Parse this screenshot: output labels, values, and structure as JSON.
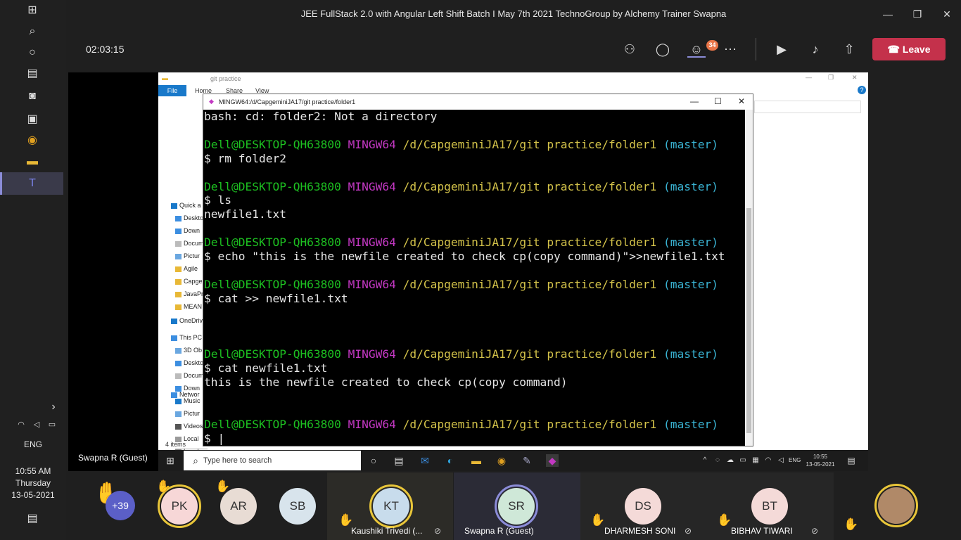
{
  "window": {
    "title": "JEE FullStack 2.0 with Angular Left Shift Batch I May 7th 2021 TechnoGroup by Alchemy Trainer Swapna"
  },
  "toolbar": {
    "timer": "02:03:15",
    "participants_badge": "34",
    "leave_label": "Leave",
    "icons": [
      "people-icon",
      "chat-icon",
      "reactions-icon",
      "more-icon",
      "camera-off-icon",
      "mic-off-icon",
      "share-icon"
    ]
  },
  "explorer": {
    "path": "git practice",
    "ribbon": [
      "File",
      "Home",
      "Share",
      "View"
    ],
    "nav": [
      "Quick a",
      "Deskto",
      "Down",
      "Docum",
      "Pictur",
      "Agile",
      "Capge",
      "JavaPr",
      "MEAN",
      "OneDriv",
      "This PC",
      "3D Ob",
      "Deskto",
      "Docum",
      "Down",
      "Music",
      "Pictur",
      "Videos",
      "Local",
      "Local",
      "Networ"
    ],
    "status": "4 items"
  },
  "terminal": {
    "title": "MINGW64:/d/CapgeminiJA17/git practice/folder1",
    "user": "Dell@DESKTOP-QH63800",
    "shell": "MINGW64",
    "path": "/d/CapgeminiJA17/git practice/folder1",
    "branch": "(master)",
    "line1": "bash: cd: folder2: Not a directory",
    "cmd1": "$ rm folder2",
    "cmd2": "$ ls",
    "out2": "newfile1.txt",
    "cmd3": "$ echo \"this is the newfile created to check cp(copy command)\">>newfile1.txt",
    "cmd4": "$ cat >> newfile1.txt",
    "cmd5": "$ cat newfile1.txt",
    "out5": "this is the newfile created to check cp(copy command)",
    "prompt": "$"
  },
  "inner_taskbar": {
    "search_placeholder": "Type here to search",
    "lang": "ENG",
    "time": "10:55",
    "date": "13-05-2021"
  },
  "presenter": "Swapna R (Guest)",
  "system": {
    "lang": "ENG",
    "time": "10:55 AM",
    "day": "Thursday",
    "date": "13-05-2021"
  },
  "participants": {
    "overflow": "+39",
    "list": [
      {
        "initials": "PK",
        "color": "#f7d7d7"
      },
      {
        "initials": "AR",
        "color": "#e8dcd4"
      },
      {
        "initials": "SB",
        "color": "#d8e4ec"
      },
      {
        "initials": "KT",
        "color": "#c8dcec",
        "name": "Kaushiki Trivedi (..."
      },
      {
        "initials": "SR",
        "color": "#cfe8d8",
        "name": "Swapna R (Guest)"
      },
      {
        "initials": "DS",
        "color": "#f4dad8",
        "name": "DHARMESH SONI"
      },
      {
        "initials": "BT",
        "color": "#f4dad8",
        "name": "BIBHAV TIWARI"
      }
    ]
  }
}
